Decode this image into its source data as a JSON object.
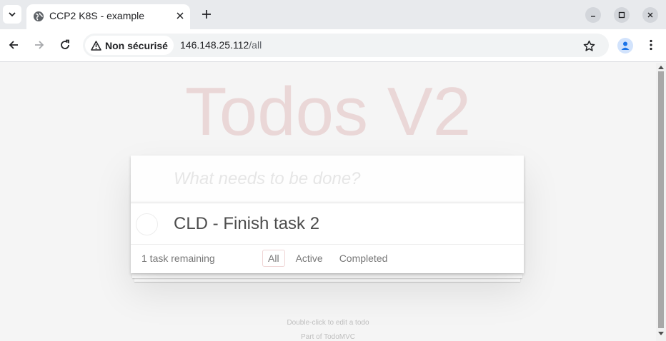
{
  "browser": {
    "tab_title": "CCP2 K8S - example",
    "security_label": "Non sécurisé",
    "url_host": "146.148.25.112",
    "url_path": "/all",
    "icons": [
      "tab-search-icon",
      "globe-icon",
      "close-icon",
      "plus-icon",
      "minimize-icon",
      "maximize-icon",
      "close-window-icon",
      "back-icon",
      "forward-icon",
      "reload-icon",
      "warning-icon",
      "star-icon",
      "profile-icon",
      "kebab-menu-icon"
    ]
  },
  "app": {
    "title": "Todos V2",
    "new_todo_placeholder": "What needs to be done?",
    "todos": [
      {
        "label": "CLD - Finish task 2",
        "completed": false
      }
    ],
    "footer": {
      "count_text": "1 task remaining",
      "filters": [
        "All",
        "Active",
        "Completed"
      ],
      "selected_filter": "All"
    },
    "info": {
      "hint": "Double-click to edit a todo",
      "credit": "Part of TodoMVC"
    }
  },
  "colors": {
    "title": "#af2f2f",
    "background": "#f5f5f5",
    "text": "#4d4d4d"
  }
}
